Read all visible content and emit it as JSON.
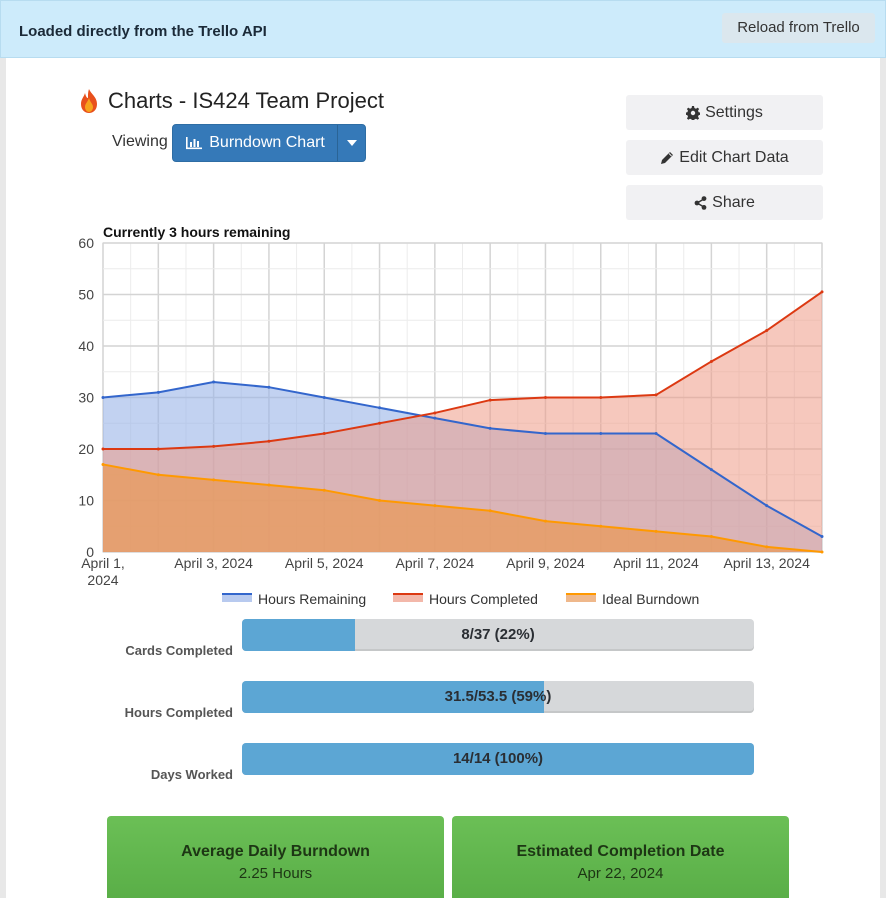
{
  "banner": {
    "text": "Loaded directly from the Trello API",
    "reload_label": "Reload from Trello"
  },
  "header": {
    "title": "Charts - IS424 Team Project",
    "viewing_label": "Viewing",
    "view_button_label": "Burndown Chart"
  },
  "side_buttons": {
    "settings": "Settings",
    "edit": "Edit Chart Data",
    "share": "Share"
  },
  "chart_data": {
    "type": "area",
    "title": "Currently 3 hours remaining",
    "x_labels": [
      "April 1, 2024",
      "April 3, 2024",
      "April 5, 2024",
      "April 7, 2024",
      "April 9, 2024",
      "April 11, 2024",
      "April 13, 2024"
    ],
    "x": [
      1,
      2,
      3,
      4,
      5,
      6,
      7,
      8,
      9,
      10,
      11,
      12,
      13,
      14
    ],
    "ylim": [
      0,
      60
    ],
    "y_ticks": [
      0,
      10,
      20,
      30,
      40,
      50,
      60
    ],
    "grid": true,
    "legend_position": "bottom",
    "series": [
      {
        "name": "Hours Remaining",
        "color": "#3366cc",
        "fill": "#9ab4e8",
        "values": [
          30,
          31,
          33,
          32,
          30,
          28,
          26,
          24,
          23,
          23,
          23,
          16,
          9,
          3
        ]
      },
      {
        "name": "Hours Completed",
        "color": "#dc3912",
        "fill": "#ee9a86",
        "values": [
          20,
          20,
          20.5,
          21.5,
          23,
          25,
          27,
          29.5,
          30,
          30,
          30.5,
          37,
          43,
          50.5
        ]
      },
      {
        "name": "Ideal Burndown",
        "color": "#ff9900",
        "fill": "#e89a5a",
        "values": [
          17,
          15,
          14,
          13,
          12,
          10,
          9,
          8,
          6,
          5,
          4,
          3,
          1,
          0
        ]
      }
    ]
  },
  "progress": [
    {
      "label": "Cards Completed",
      "text": "8/37 (22%)",
      "fraction": 0.22
    },
    {
      "label": "Hours Completed",
      "text": "31.5/53.5 (59%)",
      "fraction": 0.59
    },
    {
      "label": "Days Worked",
      "text": "14/14 (100%)",
      "fraction": 1.0
    }
  ],
  "stats": [
    {
      "title": "Average Daily Burndown",
      "value": "2.25 Hours"
    },
    {
      "title": "Estimated Completion Date",
      "value": "Apr 22, 2024"
    }
  ]
}
